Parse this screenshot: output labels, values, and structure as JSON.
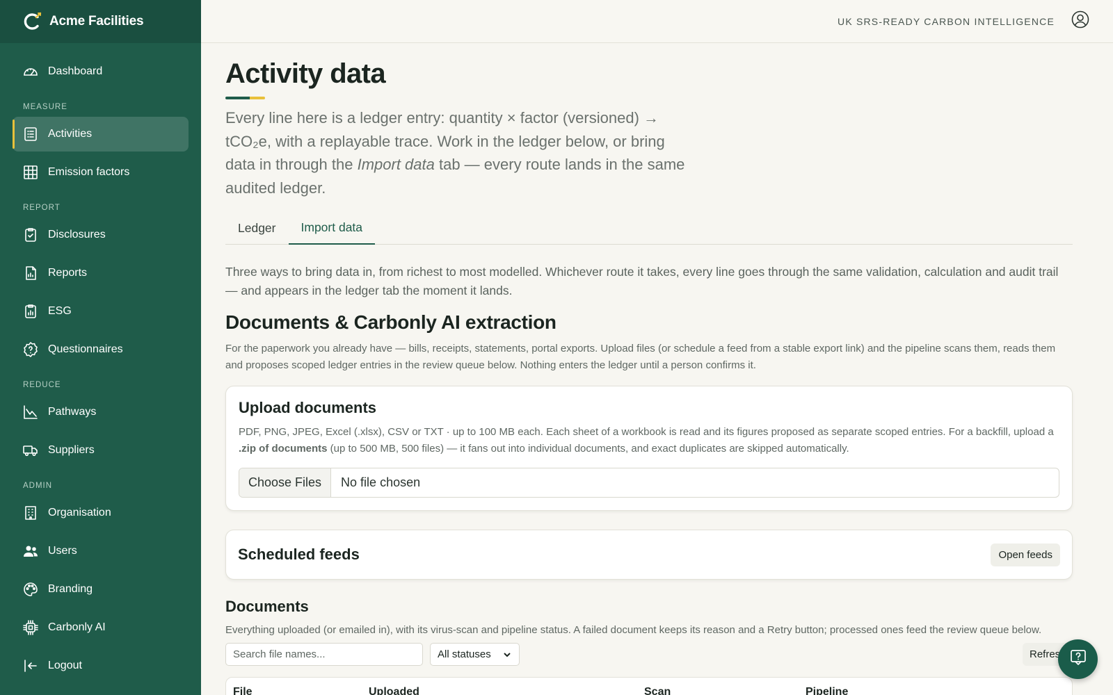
{
  "brand": {
    "name": "Acme Facilities",
    "logo_icon": "carbonly-logo-icon"
  },
  "topbar": {
    "tagline": "UK SRS-READY CARBON INTELLIGENCE",
    "user_icon": "user-circle-icon"
  },
  "sidebar": {
    "dashboard": "Dashboard",
    "sections": {
      "measure": "MEASURE",
      "report": "REPORT",
      "reduce": "REDUCE",
      "admin": "ADMIN"
    },
    "items": {
      "activities": "Activities",
      "emission_factors": "Emission factors",
      "disclosures": "Disclosures",
      "reports": "Reports",
      "esg": "ESG",
      "questionnaires": "Questionnaires",
      "pathways": "Pathways",
      "suppliers": "Suppliers",
      "organisation": "Organisation",
      "users": "Users",
      "branding": "Branding",
      "carbonly_ai": "Carbonly AI",
      "logout": "Logout"
    },
    "active": "Activities",
    "accent_color": "#e9c13b",
    "background_color": "#1f5c4a"
  },
  "page": {
    "title": "Activity data",
    "intro_part1": "Every line here is a ledger entry: quantity × factor (versioned) → tCO₂e, with a replayable trace. Work in the ledger below, or bring data in through the ",
    "intro_em": "Import data",
    "intro_part2": " tab — every route lands in the same audited ledger."
  },
  "tabs": {
    "ledger": "Ledger",
    "import": "Import data",
    "active": "Import data"
  },
  "import": {
    "lead": "Three ways to bring data in, from richest to most modelled. Whichever route it takes, every line goes through the same validation, calculation and audit trail — and appears in the ledger tab the moment it lands.",
    "section_title": "Documents & Carbonly AI extraction",
    "section_desc": "For the paperwork you already have — bills, receipts, statements, portal exports. Upload files (or schedule a feed from a stable export link) and the pipeline scans them, reads them and proposes scoped ledger entries in the review queue below. Nothing enters the ledger until a person confirms it.",
    "upload": {
      "title": "Upload documents",
      "desc_part1": "PDF, PNG, JPEG, Excel (.xlsx), CSV or TXT · up to 100 MB each. Each sheet of a workbook is read and its figures proposed as separate scoped entries. For a backfill, upload a ",
      "desc_bold": ".zip of documents",
      "desc_part2": " (up to 500 MB, 500 files) — it fans out into individual documents, and exact duplicates are skipped automatically.",
      "choose_button": "Choose Files",
      "file_status": "No file chosen"
    },
    "feeds": {
      "title": "Scheduled feeds",
      "open_button": "Open feeds"
    },
    "documents": {
      "title": "Documents",
      "desc": "Everything uploaded (or emailed in), with its virus-scan and pipeline status. A failed document keeps its reason and a Retry button; processed ones feed the review queue below.",
      "search_placeholder": "Search file names...",
      "status_filter": "All statuses",
      "refresh_button": "Refresh",
      "columns": [
        "File",
        "Uploaded",
        "Scan",
        "Pipeline"
      ]
    }
  },
  "help_fab_icon": "help-chat-icon"
}
